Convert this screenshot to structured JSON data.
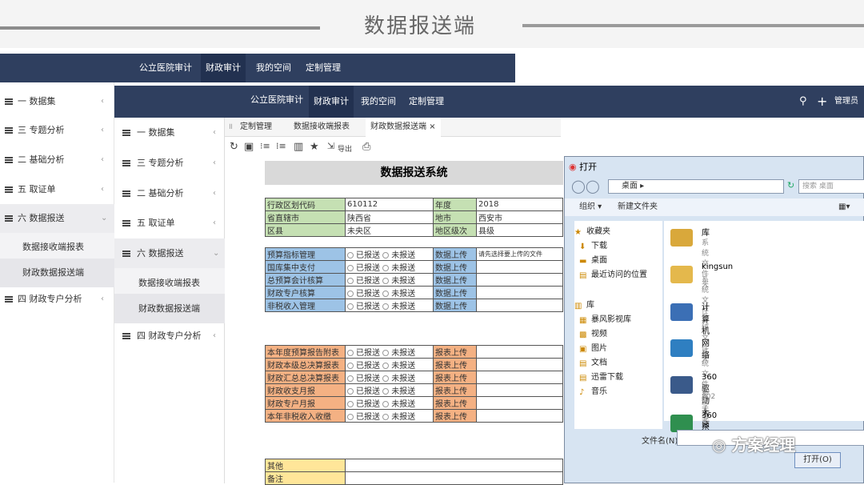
{
  "page_title": "数据报送端",
  "back_window": {
    "nav": [
      "公立医院审计",
      "财政审计",
      "我的空间",
      "定制管理"
    ],
    "sidebar": [
      {
        "label": "一 数据集",
        "chev": "‹"
      },
      {
        "label": "三 专题分析",
        "chev": "‹"
      },
      {
        "label": "二 基础分析",
        "chev": "‹"
      },
      {
        "label": "五 取证单",
        "chev": "‹"
      },
      {
        "label": "六 数据报送",
        "chev": "⌄"
      },
      {
        "label": "数据接收端报表",
        "chev": ""
      },
      {
        "label": "财政数据报送端",
        "chev": ""
      },
      {
        "label": "四 财政专户分析",
        "chev": "‹"
      }
    ]
  },
  "front_window": {
    "nav": [
      "公立医院审计",
      "财政审计",
      "我的空间",
      "定制管理"
    ],
    "admin": "管理员 ∨",
    "sidebar": [
      {
        "label": "一 数据集",
        "chev": "‹"
      },
      {
        "label": "三 专题分析",
        "chev": "‹"
      },
      {
        "label": "二 基础分析",
        "chev": "‹"
      },
      {
        "label": "五 取证单",
        "chev": "‹"
      },
      {
        "label": "六 数据报送",
        "chev": "⌄"
      },
      {
        "label": "数据接收端报表",
        "chev": ""
      },
      {
        "label": "财政数据报送端",
        "chev": ""
      },
      {
        "label": "四 财政专户分析",
        "chev": "‹"
      }
    ],
    "tabs": [
      "定制管理",
      "数据接收端报表",
      "财政数据报送端"
    ],
    "tab_close": "×",
    "toolbar_export": "导出"
  },
  "form": {
    "title": "数据报送系统",
    "info": [
      [
        "行政区划代码",
        "610112",
        "年度",
        "2018"
      ],
      [
        "省直辖市",
        "陕西省",
        "地市",
        "西安市"
      ],
      [
        "区县",
        "未央区",
        "地区级次",
        "县级"
      ]
    ],
    "sent": "已报送",
    "unsent": "未报送",
    "group1_button": "数据上传",
    "group2_button": "报表上传",
    "upload_hint": "请先选择要上传的文件",
    "group1": [
      "预算指标管理",
      "国库集中支付",
      "总预算会计核算",
      "财政专户核算",
      "非税收入管理"
    ],
    "group2": [
      "本年度预算报告附表",
      "财政本级总决算报表",
      "财政汇总总决算报表",
      "财政收支月报",
      "财政专户月报",
      "本年非税收入收缴"
    ],
    "other": [
      "其他",
      "备注"
    ]
  },
  "dialog": {
    "title": "打开",
    "address": "桌面 ▸",
    "search_placeholder": "搜索 桌面",
    "organize": "组织 ▾",
    "new_folder": "新建文件夹",
    "left": [
      "收藏夹",
      "下载",
      "桌面",
      "最近访问的位置",
      "库",
      "暴风影视库",
      "视频",
      "图片",
      "文档",
      "迅雷下载",
      "音乐"
    ],
    "files": [
      {
        "name": "库",
        "desc": "系统文件夹"
      },
      {
        "name": "kingsun",
        "desc": "系统文件夹"
      },
      {
        "name": "计算机",
        "desc": "系统文件夹"
      },
      {
        "name": "网络",
        "desc": "系统文件夹"
      },
      {
        "name": "360驱动大师",
        "desc": "快捷方式",
        "size": "802 字节"
      },
      {
        "name": "360杀毒",
        "desc": ""
      }
    ],
    "filename_label": "文件名(N):",
    "open_button": "打开(O)"
  },
  "watermark": "方案经理",
  "colors": {
    "nav": "#2f3f5f",
    "green": "#c5e0b3",
    "blue": "#9dc3e6",
    "orange": "#f4b183",
    "yellow": "#ffe699"
  }
}
